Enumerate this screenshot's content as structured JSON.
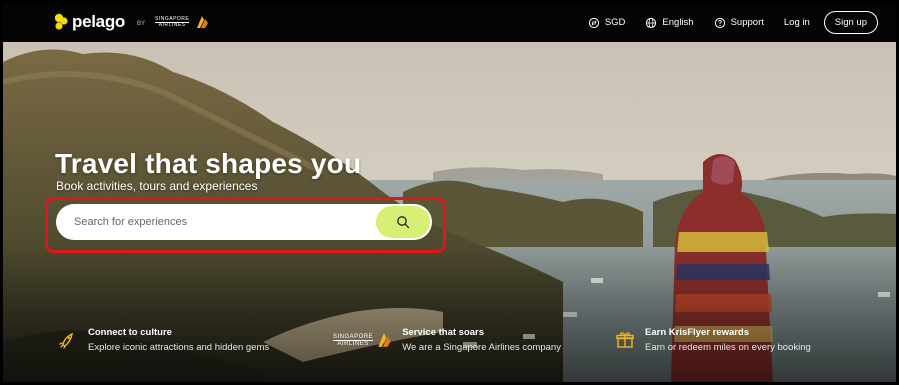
{
  "brand": {
    "name": "pelago",
    "by": "BY",
    "partner_line1": "SINGAPORE",
    "partner_line2": "AIRLINES"
  },
  "nav": {
    "currency": "SGD",
    "language": "English",
    "support": "Support",
    "login": "Log in",
    "signup": "Sign up"
  },
  "hero": {
    "headline": "Travel that shapes you",
    "subline": "Book activities, tours and experiences",
    "search_placeholder": "Search for experiences"
  },
  "benefits": [
    {
      "title": "Connect to culture",
      "desc": "Explore iconic attractions and hidden gems",
      "icon": "rocket-icon"
    },
    {
      "title": "Service that soars",
      "desc": "We are a Singapore Airlines company",
      "icon": "singapore-airlines-logo",
      "logo_line1": "SINGAPORE",
      "logo_line2": "AIRLINES"
    },
    {
      "title": "Earn KrisFlyer rewards",
      "desc": "Earn or redeem miles on every booking",
      "icon": "gift-icon"
    }
  ],
  "colors": {
    "accent_lime": "#d6ef74",
    "logo_yellow": "#f5d90a",
    "highlight_red": "#e4141b",
    "nav_bg": "#050505",
    "icon_gold": "#f2b51f"
  }
}
